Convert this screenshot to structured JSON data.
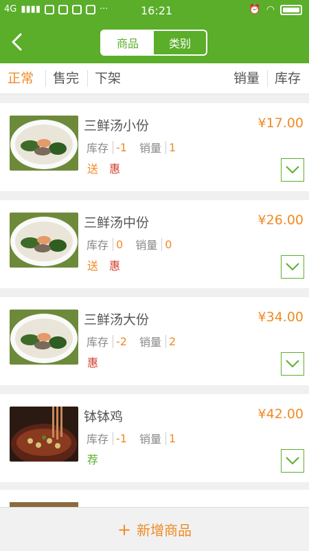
{
  "status_bar": {
    "network": "4G",
    "time": "16:21"
  },
  "nav": {
    "tabs": [
      {
        "label": "商品",
        "active": true
      },
      {
        "label": "类别",
        "active": false
      }
    ]
  },
  "filters": {
    "left": [
      "正常",
      "售完",
      "下架"
    ],
    "active": "正常",
    "right": [
      "销量",
      "库存"
    ]
  },
  "labels": {
    "stock": "库存",
    "sales": "销量"
  },
  "products": [
    {
      "name": "三鲜汤小份",
      "price": "¥17.00",
      "stock": "-1",
      "sales": "1",
      "tags": [
        "送",
        "惠"
      ],
      "image": "soup"
    },
    {
      "name": "三鲜汤中份",
      "price": "¥26.00",
      "stock": "0",
      "sales": "0",
      "tags": [
        "送",
        "惠"
      ],
      "image": "soup"
    },
    {
      "name": "三鲜汤大份",
      "price": "¥34.00",
      "stock": "-2",
      "sales": "2",
      "tags": [
        "惠"
      ],
      "image": "soup"
    },
    {
      "name": "钵钵鸡",
      "price": "¥42.00",
      "stock": "-1",
      "sales": "1",
      "tags": [
        "荐"
      ],
      "image": "bobo-chicken"
    }
  ],
  "bottom": {
    "plus": "+",
    "add_label": "新增商品"
  },
  "colors": {
    "brand_green": "#5aae2a",
    "accent_orange": "#f08a24",
    "tag_red": "#d03b2b"
  }
}
